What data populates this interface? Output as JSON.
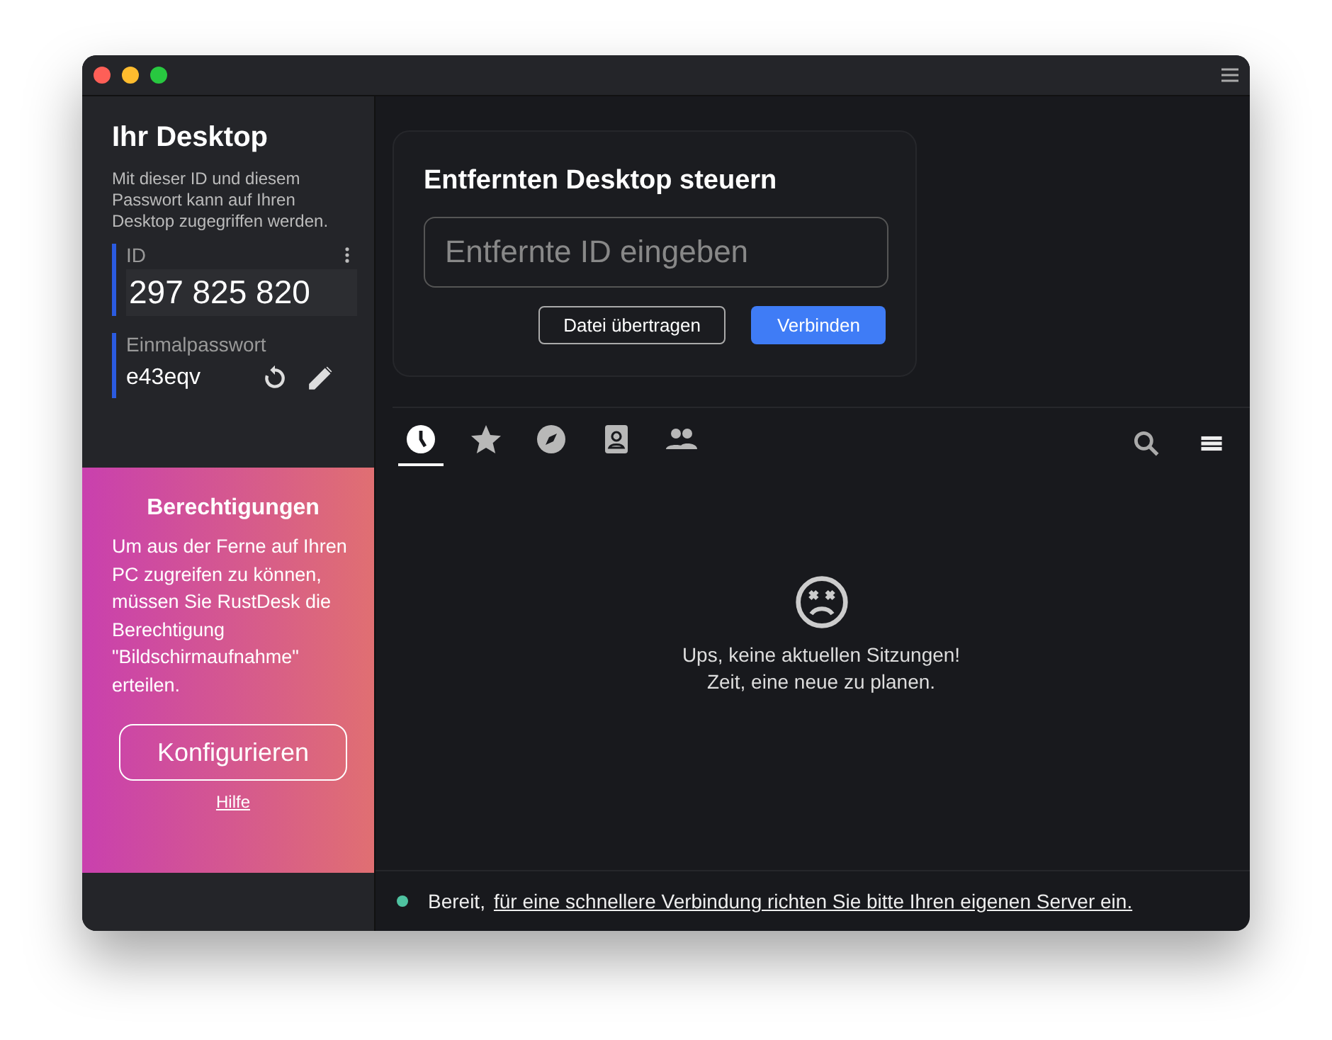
{
  "sidebar": {
    "title": "Ihr Desktop",
    "description": "Mit dieser ID und diesem Passwort kann auf Ihren Desktop zugegriffen werden.",
    "id_label": "ID",
    "id_value": "297 825 820",
    "password_label": "Einmalpasswort",
    "password_value": "e43eqv",
    "permissions": {
      "title": "Berechtigungen",
      "text": "Um aus der Ferne auf Ihren PC zugreifen zu können, müssen Sie RustDesk die Berechtigung \"Bildschirmaufnahme\" erteilen.",
      "button": "Konfigurieren",
      "help": "Hilfe"
    }
  },
  "connect": {
    "title": "Entfernten Desktop steuern",
    "placeholder": "Entfernte ID eingeben",
    "buttons": [
      {
        "label": "Datei übertragen",
        "kind": "outline"
      },
      {
        "label": "Verbinden",
        "kind": "primary"
      }
    ]
  },
  "tabs": [
    {
      "kind": "recent",
      "selected": true
    },
    {
      "kind": "favorites",
      "selected": false
    },
    {
      "kind": "discovered",
      "selected": false
    },
    {
      "kind": "addressbook",
      "selected": false
    },
    {
      "kind": "group",
      "selected": false
    }
  ],
  "empty": {
    "line1": "Ups, keine aktuellen Sitzungen!",
    "line2": "Zeit, eine neue zu planen."
  },
  "status_bar": {
    "status": "Bereit,",
    "color": "#4fc3a1",
    "link": "für eine schnellere Verbindung richten Sie bitte Ihren eigenen Server ein."
  }
}
